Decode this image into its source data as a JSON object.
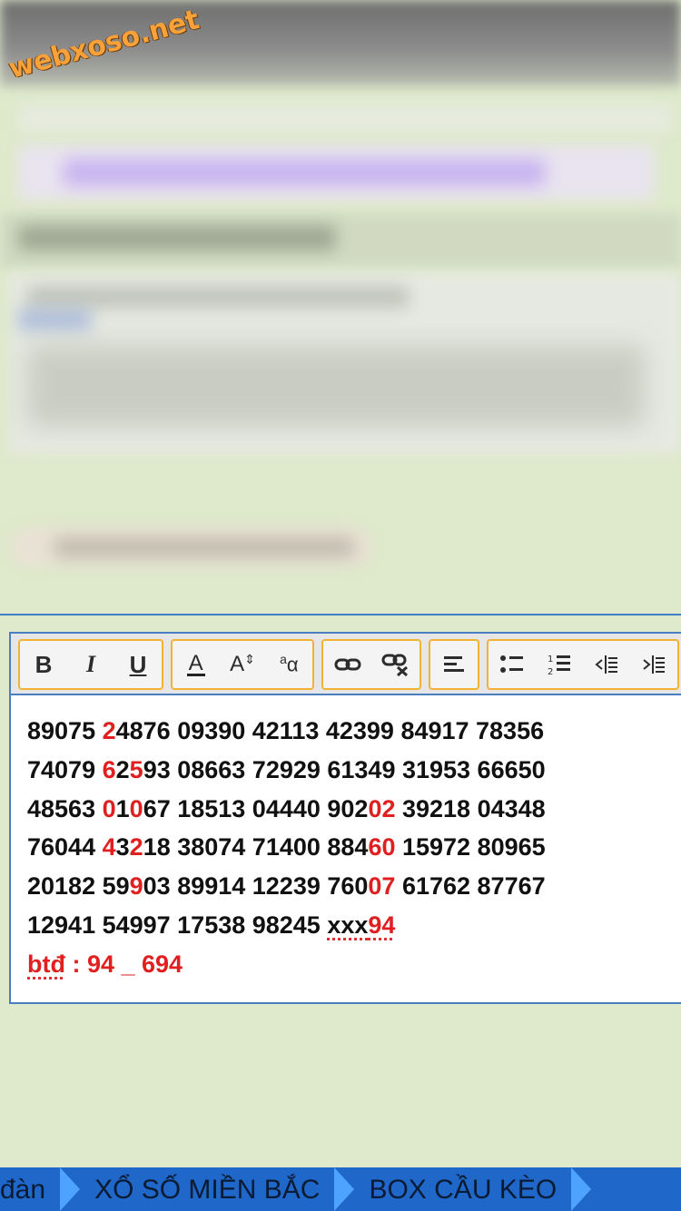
{
  "watermark": "webxoso.net",
  "toolbar": {
    "bold": "B",
    "italic": "I",
    "underline": "U",
    "font_color": "A",
    "font_size": "A",
    "change_case": "a"
  },
  "lines": [
    [
      {
        "t": "89075 "
      },
      {
        "t": "2",
        "r": true
      },
      {
        "t": "4876 09390 42113 42399 84917 78356"
      }
    ],
    [
      {
        "t": "74079 "
      },
      {
        "t": "6",
        "r": true
      },
      {
        "t": "2"
      },
      {
        "t": "5",
        "r": true
      },
      {
        "t": "93 08663 72929 61349 31953 66650"
      }
    ],
    [
      {
        "t": "48563 "
      },
      {
        "t": "0",
        "r": true
      },
      {
        "t": "1"
      },
      {
        "t": "0",
        "r": true
      },
      {
        "t": "67 18513 04440 902"
      },
      {
        "t": "02",
        "r": true
      },
      {
        "t": " 39218 04348"
      }
    ],
    [
      {
        "t": "76044 "
      },
      {
        "t": "4",
        "r": true
      },
      {
        "t": "3"
      },
      {
        "t": "2",
        "r": true
      },
      {
        "t": "18 38074 71400 884"
      },
      {
        "t": "60",
        "r": true
      },
      {
        "t": " 15972 80965"
      }
    ],
    [
      {
        "t": "20182 59"
      },
      {
        "t": "9",
        "r": true
      },
      {
        "t": "03 89914 12239 760"
      },
      {
        "t": "07",
        "r": true
      },
      {
        "t": " 61762 87767"
      }
    ],
    [
      {
        "t": "12941 54997 17538 98245 "
      },
      {
        "t": "xxx",
        "sq": true
      },
      {
        "t": "94",
        "r": true,
        "sq": true
      }
    ],
    [
      {
        "t": "btđ",
        "r": true,
        "sq": true
      },
      {
        "t": " : 94 _ 694",
        "r": true
      }
    ]
  ],
  "nav": [
    "đàn",
    "XỔ SỐ MIỀN BẮC",
    "BOX CẦU KÈO"
  ]
}
